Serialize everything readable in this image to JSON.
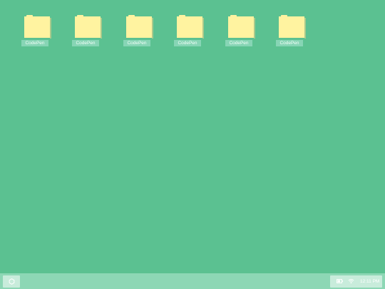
{
  "desktop": {
    "background_color": "#5bc191",
    "folders": [
      {
        "label": "CodePen",
        "icon": "folder-icon"
      },
      {
        "label": "CodePen",
        "icon": "folder-icon"
      },
      {
        "label": "CodePen",
        "icon": "folder-icon"
      },
      {
        "label": "CodePen",
        "icon": "folder-icon"
      },
      {
        "label": "CodePen",
        "icon": "folder-icon"
      },
      {
        "label": "CodePen",
        "icon": "folder-icon"
      }
    ]
  },
  "taskbar": {
    "start_icon": "hexagon-icon",
    "tray": {
      "battery_icon": "battery-icon",
      "wifi_icon": "wifi-icon",
      "clock": "12:11 PM"
    }
  },
  "colors": {
    "folder": "#fff3a0",
    "taskbar": "#8dd7b5",
    "tray": "#c8ecdb"
  }
}
